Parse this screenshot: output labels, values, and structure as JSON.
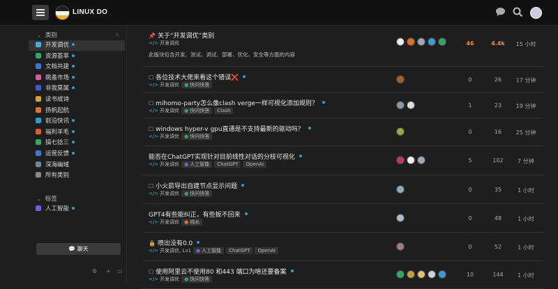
{
  "header": {
    "brand": "LINUX DO"
  },
  "sidebar": {
    "sections": [
      {
        "title": "类别",
        "items": [
          {
            "label": "开发调优",
            "color": "#3ab0e0",
            "active": true,
            "dot": true
          },
          {
            "label": "资源荟萃",
            "color": "#2fa866",
            "active": false,
            "dot": true
          },
          {
            "label": "文档共建",
            "color": "#3a7ad6",
            "active": false,
            "dot": true
          },
          {
            "label": "跳蚤市场",
            "color": "#d65a9a",
            "active": false,
            "dot": true
          },
          {
            "label": "非我莫属",
            "color": "#3a5ad6",
            "active": false,
            "dot": true
          },
          {
            "label": "读书成诗",
            "color": "#e0a030",
            "active": false,
            "dot": false
          },
          {
            "label": "扬帆起航",
            "color": "#e0702a",
            "active": false,
            "dot": false
          },
          {
            "label": "前沿快讯",
            "color": "#2a9fd6",
            "active": false,
            "dot": true
          },
          {
            "label": "福利羊毛",
            "color": "#e05a2a",
            "active": false,
            "dot": true
          },
          {
            "label": "搞七捻三",
            "color": "#2fa866",
            "active": false,
            "dot": true
          },
          {
            "label": "运营反馈",
            "color": "#3a7ad6",
            "active": false,
            "dot": true
          },
          {
            "label": "深海幽域",
            "color": "#6a8aa0",
            "active": false,
            "dot": false
          },
          {
            "label": "所有类别",
            "color": "#888888",
            "active": false,
            "dot": false
          }
        ]
      },
      {
        "title": "标签",
        "items": [
          {
            "label": "人工智能",
            "color": "#7a5ad6",
            "active": false,
            "dot": true
          }
        ]
      }
    ],
    "chat_label": "聊天"
  },
  "topics": [
    {
      "title": "关于“开发调优”类别",
      "pinned": true,
      "locked": false,
      "unread": false,
      "category": "开发调优",
      "tags": [],
      "excerpt": "此版块包含开发、测试、调试、部署、优化、安全等方面的内容",
      "emoji": "",
      "avatars": [
        "#eeeeee",
        "#e07020",
        "#99aabb",
        "#3a9ad6",
        "#2fa866"
      ],
      "replies": "46",
      "views": "4.4k",
      "activity": "15 小时",
      "hot": true
    },
    {
      "title": "各位技术大佬来看这个错误",
      "pinned": false,
      "locked": false,
      "unread": true,
      "category": "开发调优",
      "tags": [
        {
          "label": "快问快答",
          "color": "#2fa866"
        }
      ],
      "excerpt": "",
      "emoji": "❌",
      "avatars": [
        "#a0602a"
      ],
      "replies": "0",
      "views": "26",
      "activity": "17 分钟",
      "hot": false
    },
    {
      "title": "mihomo-party怎么像clash verge一样可视化添加规则？",
      "pinned": false,
      "locked": false,
      "unread": true,
      "category": "开发调优",
      "tags": [
        {
          "label": "快问快答",
          "color": "#2fa866"
        },
        {
          "label": "Clash",
          "color": ""
        }
      ],
      "excerpt": "",
      "emoji": "",
      "avatars": [
        "#8899aa",
        "#dddddd"
      ],
      "replies": "1",
      "views": "23",
      "activity": "19 分钟",
      "hot": false
    },
    {
      "title": "windows hyper-v gpu直通是不支持最新的驱动吗？",
      "pinned": false,
      "locked": false,
      "unread": true,
      "category": "开发调优",
      "tags": [
        {
          "label": "快问快答",
          "color": "#2fa866"
        }
      ],
      "excerpt": "",
      "emoji": "",
      "avatars": [
        "#9aaa3a"
      ],
      "replies": "0",
      "views": "16",
      "activity": "25 分钟",
      "hot": false
    },
    {
      "title": "能否在ChatGPT实现针对目前线性对话的分枝可视化",
      "pinned": false,
      "locked": false,
      "unread": true,
      "category": "开发调优",
      "tags": [
        {
          "label": "人工智能",
          "color": "#7a5ad6"
        },
        {
          "label": "ChatGPT",
          "color": ""
        },
        {
          "label": "OpenAI",
          "color": ""
        }
      ],
      "excerpt": "",
      "emoji": "",
      "avatars": [
        "#c03a5a",
        "#f2f2f2",
        "#9aaabb"
      ],
      "replies": "5",
      "views": "102",
      "activity": "7 分钟",
      "hot": false
    },
    {
      "title": "小火箭导出自建节点显示问题",
      "pinned": false,
      "locked": false,
      "unread": true,
      "category": "开发调优",
      "tags": [
        {
          "label": "快问快答",
          "color": "#2fa866"
        }
      ],
      "excerpt": "",
      "emoji": "",
      "avatars": [
        "#8aaac0"
      ],
      "replies": "0",
      "views": "35",
      "activity": "1 小时",
      "hot": false
    },
    {
      "title": "GPT4有些能纠正，有些扳不回来",
      "pinned": false,
      "locked": false,
      "unread": true,
      "category": "开发调优",
      "tags": [
        {
          "label": "纯水",
          "color": "#e07020"
        }
      ],
      "excerpt": "",
      "emoji": "",
      "avatars": [
        "#aabbcc"
      ],
      "replies": "0",
      "views": "48",
      "activity": "1 小时",
      "hot": false
    },
    {
      "title": "喷出没有0.0",
      "pinned": false,
      "locked": true,
      "unread": true,
      "category": "开发调优, Lv1",
      "tags": [
        {
          "label": "人工智能",
          "color": "#7a5ad6"
        },
        {
          "label": "ChatGPT",
          "color": ""
        },
        {
          "label": "OpenAI",
          "color": ""
        }
      ],
      "excerpt": "",
      "emoji": "",
      "avatars": [
        "#a07a8a"
      ],
      "replies": "0",
      "views": "52",
      "activity": "1 小时",
      "hot": false
    },
    {
      "title": "使用阿里云不使用80 和443 端口为啥还要备案",
      "pinned": false,
      "locked": false,
      "unread": true,
      "category": "开发调优",
      "tags": [
        {
          "label": "快问快答",
          "color": "#2fa866"
        }
      ],
      "excerpt": "",
      "emoji": "",
      "avatars": [
        "#2fa866",
        "#c0a040",
        "#e0c070",
        "#d0d0e0",
        "#3a9ad6"
      ],
      "replies": "10",
      "views": "144",
      "activity": "1 小时",
      "hot": false
    }
  ]
}
